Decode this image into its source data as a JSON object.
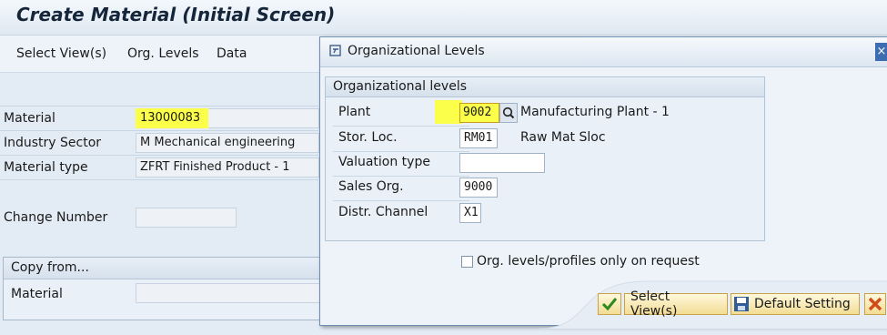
{
  "title": "Create Material (Initial Screen)",
  "menu": [
    "Select View(s)",
    "Org. Levels",
    "Data"
  ],
  "main": {
    "material": {
      "label": "Material",
      "value": "13000083"
    },
    "industry_sector": {
      "label": "Industry Sector",
      "value": "M Mechanical engineering"
    },
    "material_type": {
      "label": "Material type",
      "value": "ZFRT Finished Product - 1"
    },
    "change_number": {
      "label": "Change Number",
      "value": ""
    },
    "copy_from": {
      "title": "Copy from...",
      "material_label": "Material",
      "material_value": ""
    }
  },
  "popup": {
    "title": "Organizational Levels",
    "group_title": "Organizational levels",
    "plant": {
      "label": "Plant",
      "value": "9002",
      "description": "Manufacturing Plant - 1"
    },
    "stor_loc": {
      "label": "Stor. Loc.",
      "value": "RM01",
      "description": "Raw Mat Sloc"
    },
    "valuation_type": {
      "label": "Valuation type",
      "value": ""
    },
    "sales_org": {
      "label": "Sales Org.",
      "value": "9000"
    },
    "distr_channel": {
      "label": "Distr. Channel",
      "value": "X1"
    },
    "checkbox_label": "Org. levels/profiles only on request",
    "buttons": {
      "select_views": "Select View(s)",
      "default_setting": "Default Setting"
    }
  },
  "colors": {
    "highlight": "#fbff4a",
    "accent": "#3d6db0"
  }
}
